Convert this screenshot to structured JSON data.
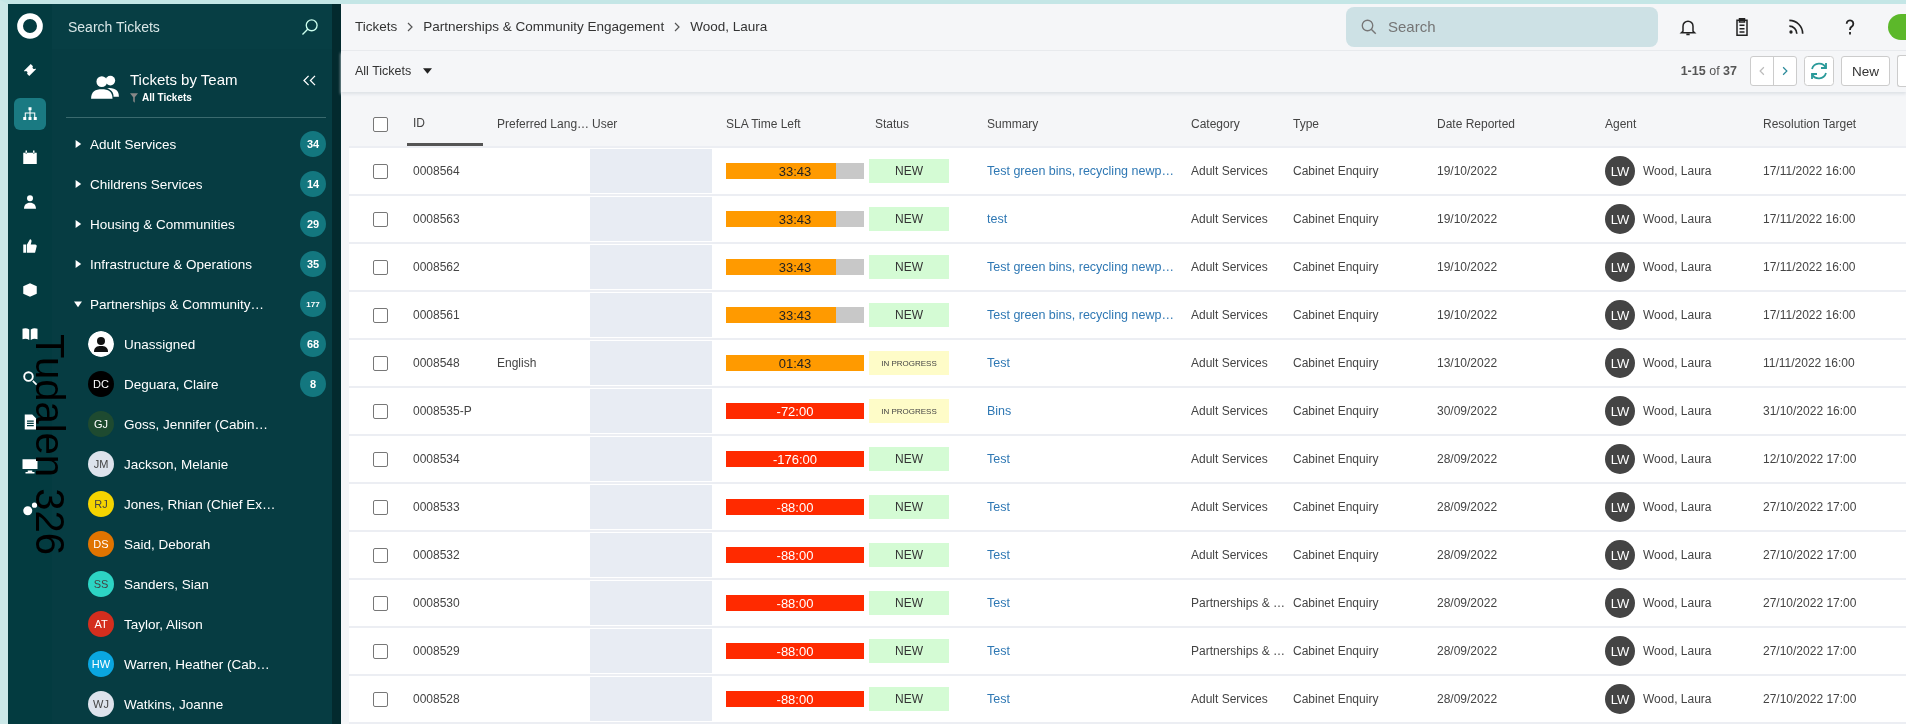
{
  "rail": [
    {
      "selected": false
    },
    {
      "selected": true
    },
    {
      "selected": false
    },
    {
      "selected": false
    },
    {
      "selected": false
    },
    {
      "selected": false
    },
    {
      "selected": false
    },
    {
      "selected": false
    },
    {
      "selected": false
    },
    {
      "selected": false
    },
    {
      "selected": false
    }
  ],
  "sidebar": {
    "search_placeholder": "Search Tickets",
    "title": "Tickets by Team",
    "filter": "All Tickets",
    "teams": [
      {
        "label": "Adult Services",
        "count": "34",
        "expanded": false
      },
      {
        "label": "Childrens Services",
        "count": "14",
        "expanded": false
      },
      {
        "label": "Housing & Communities",
        "count": "29",
        "expanded": false
      },
      {
        "label": "Infrastructure & Operations",
        "count": "35",
        "expanded": false
      },
      {
        "label": "Partnerships & Community…",
        "count": "177",
        "expanded": true,
        "children": [
          {
            "kind": "unassigned",
            "name": "Unassigned",
            "count": "68"
          },
          {
            "kind": "agent",
            "initials": "DC",
            "name": "Deguara, Claire",
            "color": "#000000",
            "count": "8"
          },
          {
            "kind": "agent",
            "initials": "GJ",
            "name": "Goss, Jennifer (Cabin…",
            "color": "#1e4a30"
          },
          {
            "kind": "agent",
            "initials": "JM",
            "name": "Jackson, Melanie",
            "color": "#dde3ec"
          },
          {
            "kind": "agent",
            "initials": "RJ",
            "name": "Jones, Rhian (Chief Ex…",
            "color": "#f5d400"
          },
          {
            "kind": "agent",
            "initials": "DS",
            "name": "Said, Deborah",
            "color": "#e07400"
          },
          {
            "kind": "agent",
            "initials": "SS",
            "name": "Sanders, Sian",
            "color": "#2dd4c4"
          },
          {
            "kind": "agent",
            "initials": "AT",
            "name": "Taylor, Alison",
            "color": "#d42e1e"
          },
          {
            "kind": "agent",
            "initials": "HW",
            "name": "Warren, Heather (Cab…",
            "color": "#0aa6e0"
          },
          {
            "kind": "agent",
            "initials": "WJ",
            "name": "Watkins, Joanne",
            "color": "#dde3ec"
          }
        ]
      }
    ]
  },
  "overlay_text": "Tudalen 326",
  "breadcrumb": [
    "Tickets",
    "Partnerships & Community Engagement",
    "Wood, Laura"
  ],
  "search": {
    "placeholder": "Search"
  },
  "view_selector": "All Tickets",
  "pagination": "**1-15** of **37**",
  "new_button": "New",
  "table": {
    "select_all": {
      "checked": false
    },
    "columns": [
      "ID",
      "Preferred Lang…",
      "User",
      "SLA Time Left",
      "Status",
      "Summary",
      "Category",
      "Type",
      "Date Reported",
      "Agent",
      "Resolution Target"
    ],
    "rows": [
      {
        "checked": false,
        "id": "0008564",
        "sla": {
          "text": "33:43",
          "kind": "warning",
          "level": 0.8
        },
        "status": {
          "text": "NEW",
          "kind": "new"
        },
        "summary": "Test green bins, recycling newp…",
        "category": "Adult Services",
        "type": "Cabinet Enquiry",
        "date": "19/10/2022",
        "agent_initials": "LW",
        "agent": "Wood, Laura",
        "target": "17/11/2022 16:00"
      },
      {
        "checked": false,
        "id": "0008563",
        "sla": {
          "text": "33:43",
          "kind": "warning",
          "level": 0.8
        },
        "status": {
          "text": "NEW",
          "kind": "new"
        },
        "summary": "test",
        "category": "Adult Services",
        "type": "Cabinet Enquiry",
        "date": "19/10/2022",
        "agent_initials": "LW",
        "agent": "Wood, Laura",
        "target": "17/11/2022 16:00"
      },
      {
        "checked": false,
        "id": "0008562",
        "sla": {
          "text": "33:43",
          "kind": "warning",
          "level": 0.8
        },
        "status": {
          "text": "NEW",
          "kind": "new"
        },
        "summary": "Test green bins, recycling newp…",
        "category": "Adult Services",
        "type": "Cabinet Enquiry",
        "date": "19/10/2022",
        "agent_initials": "LW",
        "agent": "Wood, Laura",
        "target": "17/11/2022 16:00"
      },
      {
        "checked": false,
        "id": "0008561",
        "sla": {
          "text": "33:43",
          "kind": "warning",
          "level": 0.8
        },
        "status": {
          "text": "NEW",
          "kind": "new"
        },
        "summary": "Test green bins, recycling newp…",
        "category": "Adult Services",
        "type": "Cabinet Enquiry",
        "date": "19/10/2022",
        "agent_initials": "LW",
        "agent": "Wood, Laura",
        "target": "17/11/2022 16:00"
      },
      {
        "checked": false,
        "id": "0008548",
        "language": "English",
        "sla": {
          "text": "01:43",
          "kind": "warning",
          "level": 1
        },
        "status": {
          "text": "IN PROGRESS",
          "kind": "in_progress"
        },
        "summary": "Test",
        "category": "Adult Services",
        "type": "Cabinet Enquiry",
        "date": "13/10/2022",
        "agent_initials": "LW",
        "agent": "Wood, Laura",
        "target": "11/11/2022 16:00"
      },
      {
        "checked": false,
        "id": "0008535-P",
        "sla": {
          "text": "-72:00",
          "kind": "breached",
          "level": 1
        },
        "status": {
          "text": "IN PROGRESS",
          "kind": "in_progress"
        },
        "summary": "Bins",
        "category": "Adult Services",
        "type": "Cabinet Enquiry",
        "date": "30/09/2022",
        "agent_initials": "LW",
        "agent": "Wood, Laura",
        "target": "31/10/2022 16:00"
      },
      {
        "checked": false,
        "id": "0008534",
        "sla": {
          "text": "-176:00",
          "kind": "breached",
          "level": 1
        },
        "status": {
          "text": "NEW",
          "kind": "new"
        },
        "summary": "Test",
        "category": "Adult Services",
        "type": "Cabinet Enquiry",
        "date": "28/09/2022",
        "agent_initials": "LW",
        "agent": "Wood, Laura",
        "target": "12/10/2022 17:00"
      },
      {
        "checked": false,
        "id": "0008533",
        "sla": {
          "text": "-88:00",
          "kind": "breached",
          "level": 1
        },
        "status": {
          "text": "NEW",
          "kind": "new"
        },
        "summary": "Test",
        "category": "Adult Services",
        "type": "Cabinet Enquiry",
        "date": "28/09/2022",
        "agent_initials": "LW",
        "agent": "Wood, Laura",
        "target": "27/10/2022 17:00"
      },
      {
        "checked": false,
        "id": "0008532",
        "sla": {
          "text": "-88:00",
          "kind": "breached",
          "level": 1
        },
        "status": {
          "text": "NEW",
          "kind": "new"
        },
        "summary": "Test",
        "category": "Adult Services",
        "type": "Cabinet Enquiry",
        "date": "28/09/2022",
        "agent_initials": "LW",
        "agent": "Wood, Laura",
        "target": "27/10/2022 17:00"
      },
      {
        "checked": false,
        "id": "0008530",
        "sla": {
          "text": "-88:00",
          "kind": "breached",
          "level": 1
        },
        "status": {
          "text": "NEW",
          "kind": "new"
        },
        "summary": "Test",
        "category": "Partnerships & …",
        "type": "Cabinet Enquiry",
        "date": "28/09/2022",
        "agent_initials": "LW",
        "agent": "Wood, Laura",
        "target": "27/10/2022 17:00"
      },
      {
        "checked": false,
        "id": "0008529",
        "sla": {
          "text": "-88:00",
          "kind": "breached",
          "level": 1
        },
        "status": {
          "text": "NEW",
          "kind": "new"
        },
        "summary": "Test",
        "category": "Partnerships & …",
        "type": "Cabinet Enquiry",
        "date": "28/09/2022",
        "agent_initials": "LW",
        "agent": "Wood, Laura",
        "target": "27/10/2022 17:00"
      },
      {
        "checked": false,
        "id": "0008528",
        "sla": {
          "text": "-88:00",
          "kind": "breached",
          "level": 1
        },
        "status": {
          "text": "NEW",
          "kind": "new"
        },
        "summary": "Test",
        "category": "Adult Services",
        "type": "Cabinet Enquiry",
        "date": "28/09/2022",
        "agent_initials": "LW",
        "agent": "Wood, Laura",
        "target": "27/10/2022 17:00"
      }
    ]
  }
}
